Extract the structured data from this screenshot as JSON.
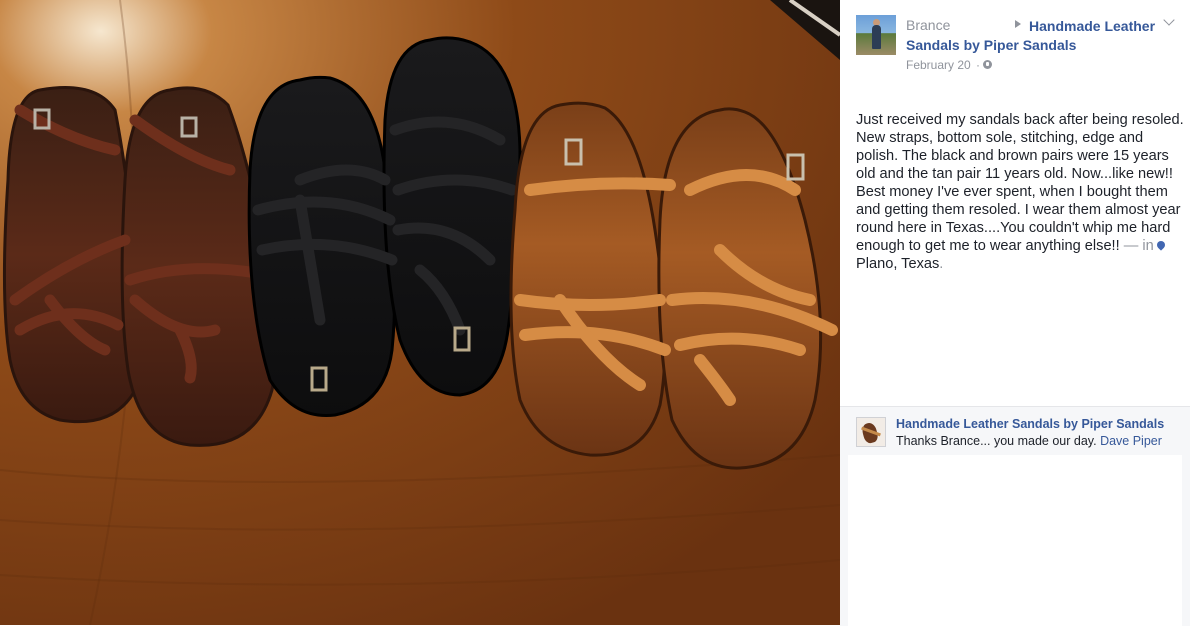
{
  "photo": {
    "alt": "",
    "icon": "sandals-photo"
  },
  "post": {
    "author": "Brance",
    "page_name": "Handmade Leather Sandals by Piper Sandals",
    "date": "February 20",
    "date_separator": "·",
    "body": "Just received my sandals back after being resoled. New straps, bottom sole, stitching, edge and polish. The black and brown pairs were 15 years old and the tan pair 11 years old. Now...like new!! Best money I've ever spent, when I bought them and getting them resoled. I wear them almost year round here in Texas....You couldn't whip me hard enough to get me to wear anything else!!",
    "location_prefix": "— in",
    "location": "Plano, Texas",
    "location_suffix": "."
  },
  "comment": {
    "author": "Handmade Leather Sandals by Piper Sandals",
    "text": "Thanks Brance... you made our day.",
    "mention": "Dave Piper"
  },
  "colors": {
    "link": "#365899",
    "meta": "#90949c",
    "text": "#1d2129",
    "table_wood": "#7a3e14"
  }
}
